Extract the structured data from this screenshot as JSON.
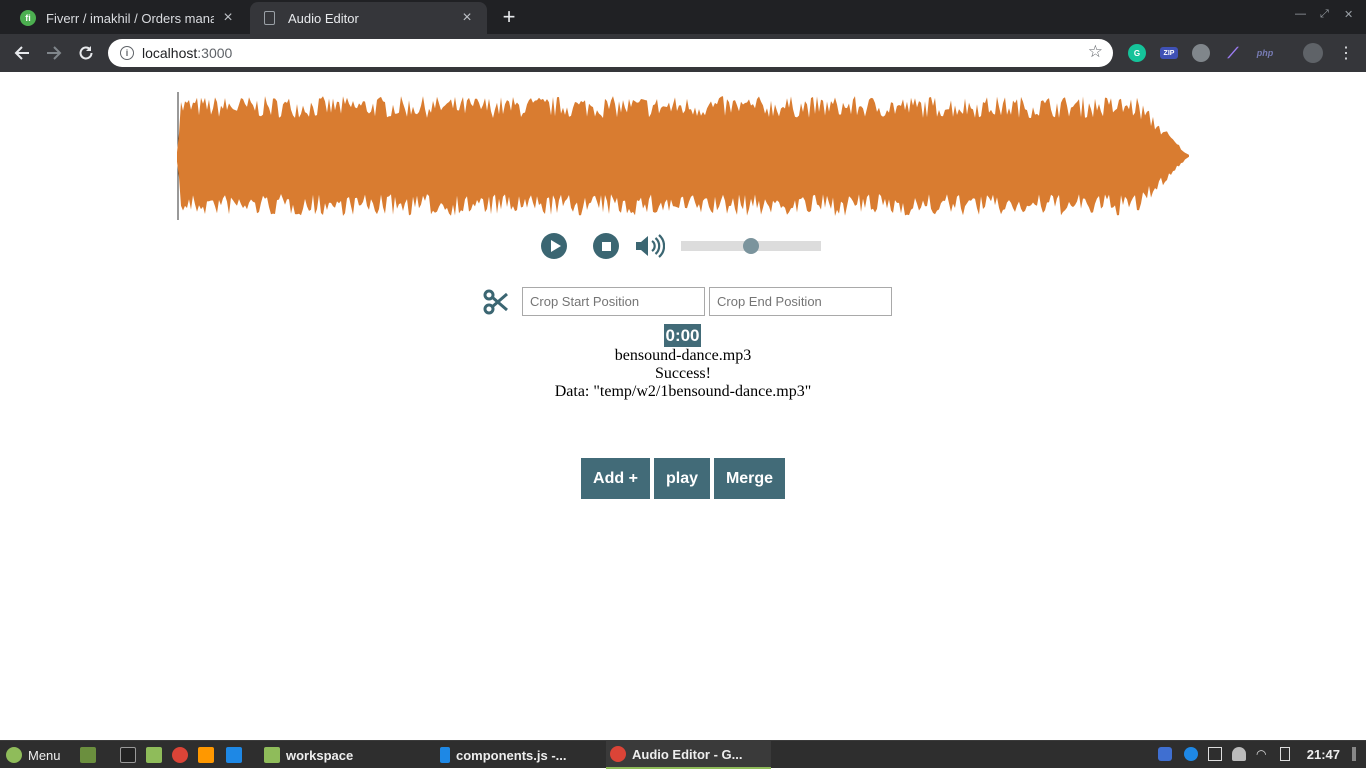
{
  "browser": {
    "tabs": [
      {
        "title": "Fiverr / imakhil / Orders manag",
        "active": false,
        "icon": "fiverr-favicon"
      },
      {
        "title": "Audio Editor",
        "active": true,
        "icon": "page-icon"
      }
    ],
    "new_tab": "+",
    "url_host": "localhost",
    "url_port": ":3000",
    "extensions": [
      "grammarly-icon",
      "zip-icon",
      "cloud-icon",
      "feather-icon",
      "php-icon",
      "profile-avatar"
    ]
  },
  "editor": {
    "waveform_color": "#d97c30",
    "volume_level": 0.5,
    "crop_start_placeholder": "Crop Start Position",
    "crop_end_placeholder": "Crop End Position",
    "time": "0:00",
    "filename": "bensound-dance.mp3",
    "status": "Success!",
    "data_line": "Data: \"temp/w2/1bensound-dance.mp3\"",
    "buttons": {
      "add": "Add +",
      "play": "play",
      "merge": "Merge"
    },
    "accent_color": "#426b78"
  },
  "taskbar": {
    "menu_label": "Menu",
    "windows": [
      {
        "label": "workspace",
        "icon": "folder-icon"
      },
      {
        "label": "components.js -...",
        "icon": "vscode-icon"
      },
      {
        "label": "Audio Editor - G...",
        "icon": "chrome-icon",
        "active": true
      }
    ],
    "clock": "21:47"
  }
}
